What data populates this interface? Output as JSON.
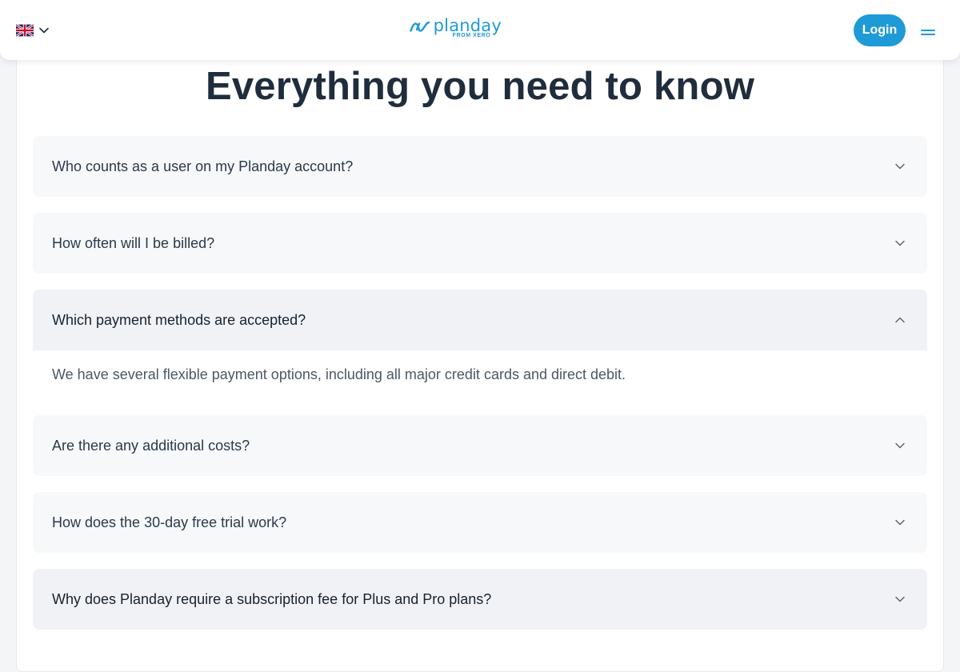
{
  "header": {
    "language_icon": "uk-flag-icon",
    "language_chevron_icon": "chevron-down-icon",
    "logo": {
      "word": "planday",
      "sub": "FROM XERO"
    },
    "login_label": "Login",
    "menu_icon": "hamburger-menu-icon"
  },
  "main": {
    "heading": "Everything you need to know",
    "faq": [
      {
        "question": "Who counts as a user on my Planday account?",
        "expanded": false,
        "chevron": "chevron-down-icon"
      },
      {
        "question": "How often will I be billed?",
        "expanded": false,
        "chevron": "chevron-down-icon"
      },
      {
        "question": "Which payment methods are accepted?",
        "expanded": true,
        "chevron": "chevron-up-icon",
        "answer": "We have several flexible payment options, including all major credit cards and direct debit."
      },
      {
        "question": "Are there any additional costs?",
        "expanded": false,
        "chevron": "chevron-down-icon"
      },
      {
        "question": "How does the 30-day free trial work?",
        "expanded": false,
        "chevron": "chevron-down-icon"
      },
      {
        "question": "Why does Planday require a subscription fee for Plus and Pro plans?",
        "expanded": false,
        "chevron": "chevron-down-icon"
      }
    ]
  },
  "colors": {
    "brand_blue": "#1e9ad6",
    "heading_text": "#1f2d3d",
    "faq_background": "#f7f8fa",
    "faq_expanded_background": "#f1f2f5"
  }
}
